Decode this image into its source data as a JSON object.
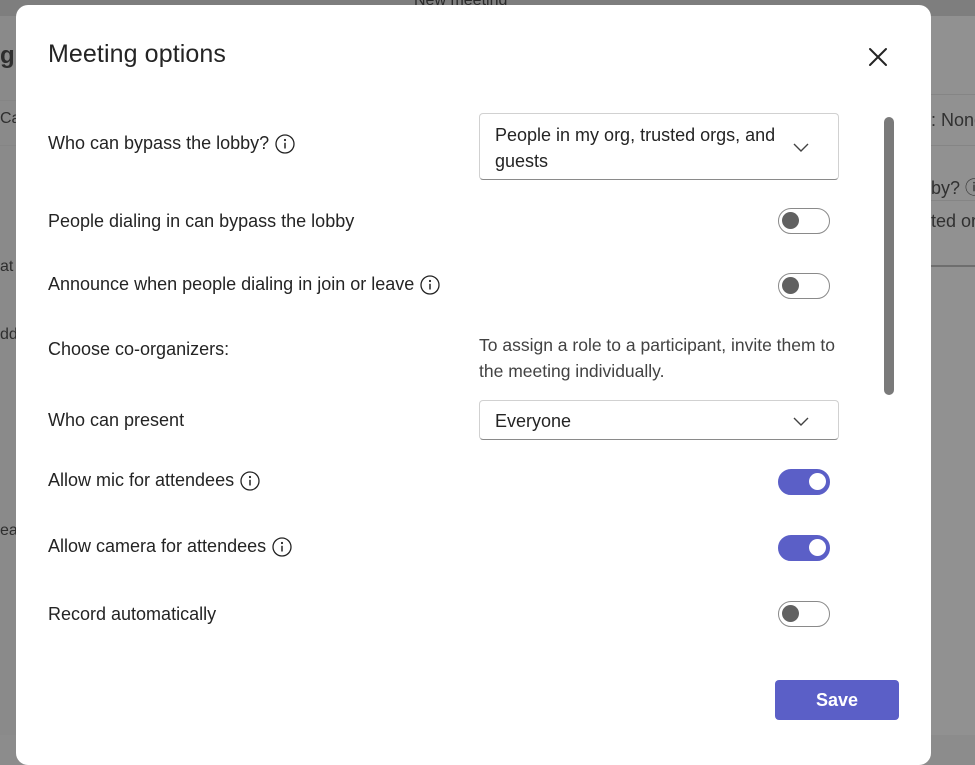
{
  "background": {
    "top_title": "New meeting",
    "left_fragments": [
      "g",
      "Ca",
      "at",
      "dd",
      "eat"
    ],
    "right_fragments": [
      ": None",
      "by? ⓘ",
      "ted or"
    ]
  },
  "dialog": {
    "title": "Meeting options",
    "close_label": "Close",
    "options": [
      {
        "label": "Who can bypass the lobby?",
        "info": true,
        "control": "dropdown",
        "value": "People in my org, trusted orgs, and guests"
      },
      {
        "label": "People dialing in can bypass the lobby",
        "info": false,
        "control": "toggle",
        "checked": false
      },
      {
        "label": "Announce when people dialing in join or leave",
        "info": true,
        "control": "toggle",
        "checked": false
      },
      {
        "label": "Choose co-organizers:",
        "info": false,
        "control": "text",
        "value": "To assign a role to a participant, invite them to the meeting individually."
      },
      {
        "label": "Who can present",
        "info": false,
        "control": "dropdown",
        "value": "Everyone"
      },
      {
        "label": "Allow mic for attendees",
        "info": true,
        "control": "toggle",
        "checked": true
      },
      {
        "label": "Allow camera for attendees",
        "info": true,
        "control": "toggle",
        "checked": true
      },
      {
        "label": "Record automatically",
        "info": false,
        "control": "toggle",
        "checked": false
      }
    ],
    "save_label": "Save"
  },
  "colors": {
    "accent": "#5b5fc7",
    "toggle_off_knob": "#616161",
    "text": "#242424",
    "overlay": "#8f8f8f"
  }
}
